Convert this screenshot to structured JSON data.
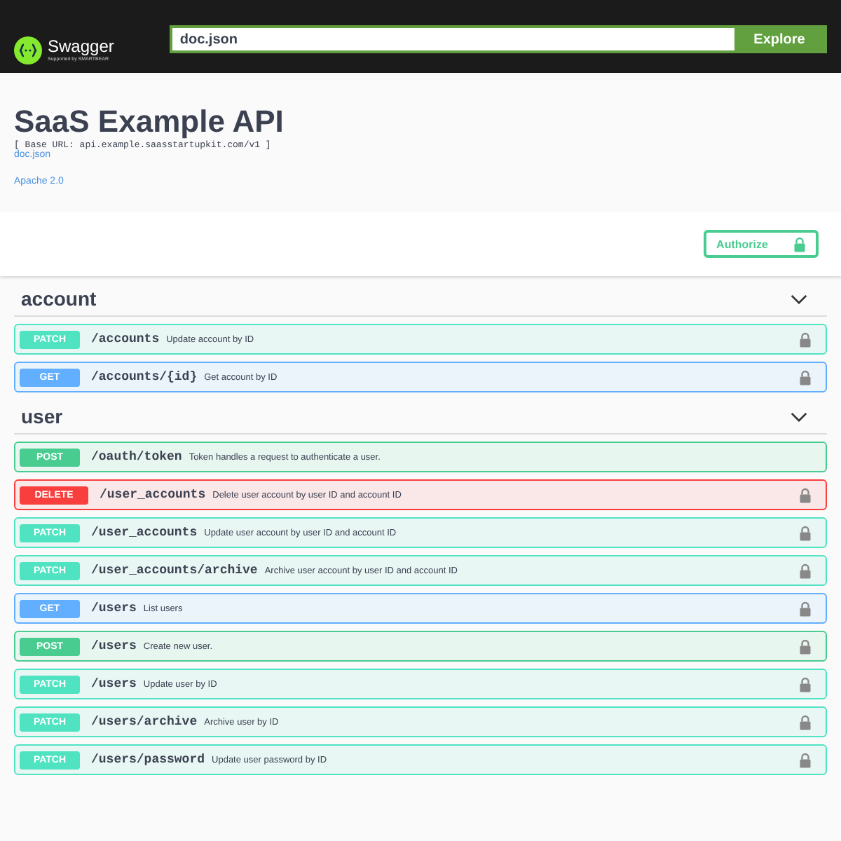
{
  "header": {
    "brand": "Swagger",
    "brand_sub": "Supported by SMARTBEAR",
    "url": "doc.json",
    "explore": "Explore"
  },
  "info": {
    "title": "SaaS Example API",
    "base_url": "[ Base URL: api.example.saasstartupkit.com/v1 ]",
    "spec_link": "doc.json",
    "license": "Apache 2.0"
  },
  "authorize": "Authorize",
  "tags": [
    {
      "name": "account",
      "expanded": true,
      "operations": [
        {
          "method": "PATCH",
          "path": "/accounts",
          "summary": "Update account by ID",
          "locked": true
        },
        {
          "method": "GET",
          "path": "/accounts/{id}",
          "summary": "Get account by ID",
          "locked": true
        }
      ]
    },
    {
      "name": "user",
      "expanded": true,
      "operations": [
        {
          "method": "POST",
          "path": "/oauth/token",
          "summary": "Token handles a request to authenticate a user.",
          "locked": false
        },
        {
          "method": "DELETE",
          "path": "/user_accounts",
          "summary": "Delete user account by user ID and account ID",
          "locked": true
        },
        {
          "method": "PATCH",
          "path": "/user_accounts",
          "summary": "Update user account by user ID and account ID",
          "locked": true
        },
        {
          "method": "PATCH",
          "path": "/user_accounts/archive",
          "summary": "Archive user account by user ID and account ID",
          "locked": true
        },
        {
          "method": "GET",
          "path": "/users",
          "summary": "List users",
          "locked": true
        },
        {
          "method": "POST",
          "path": "/users",
          "summary": "Create new user.",
          "locked": true
        },
        {
          "method": "PATCH",
          "path": "/users",
          "summary": "Update user by ID",
          "locked": true
        },
        {
          "method": "PATCH",
          "path": "/users/archive",
          "summary": "Archive user by ID",
          "locked": true
        },
        {
          "method": "PATCH",
          "path": "/users/password",
          "summary": "Update user password by ID",
          "locked": true
        }
      ]
    }
  ]
}
